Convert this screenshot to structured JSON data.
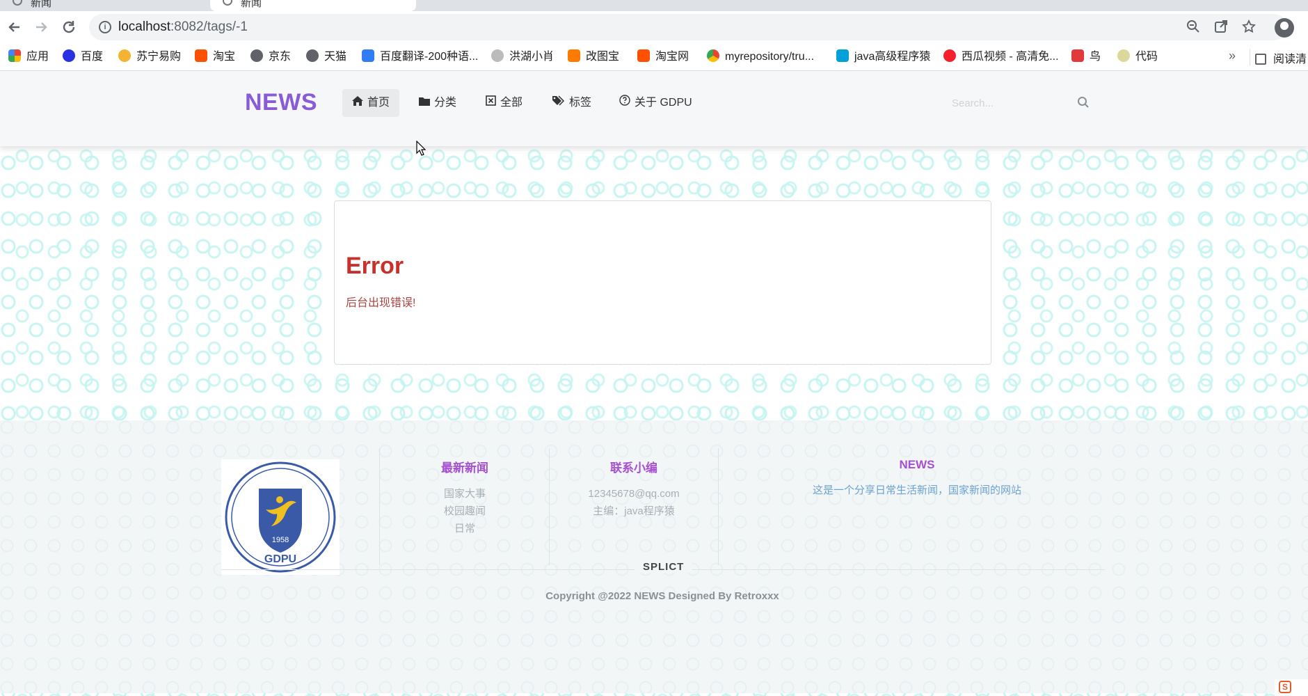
{
  "browser": {
    "tabs": [
      {
        "title": "新闻"
      },
      {
        "title": "新闻"
      }
    ],
    "url": "localhost:8082/tags/-1",
    "url_host": "localhost",
    "url_path": ":8082/tags/-1",
    "bookmarks": [
      {
        "label": "应用",
        "icon": "apps-grid-icon",
        "color": "#4285f4"
      },
      {
        "label": "百度",
        "icon": "baidu-paw-icon",
        "color": "#2932e1"
      },
      {
        "label": "苏宁易购",
        "icon": "suning-icon",
        "color": "#f5b335"
      },
      {
        "label": "淘宝",
        "icon": "taobao-icon",
        "color": "#ff5000"
      },
      {
        "label": "京东",
        "icon": "globe-icon",
        "color": "#5f6368"
      },
      {
        "label": "天猫",
        "icon": "globe-icon",
        "color": "#5f6368"
      },
      {
        "label": "百度翻译-200种语...",
        "icon": "translate-icon",
        "color": "#2f7cf6"
      },
      {
        "label": "洪湖小肖",
        "icon": "bird-icon",
        "color": "#777777"
      },
      {
        "label": "改图宝",
        "icon": "gaitubao-icon",
        "color": "#ff7a00"
      },
      {
        "label": "淘宝网",
        "icon": "taobao-icon",
        "color": "#ff5000"
      },
      {
        "label": "myrepository/tru...",
        "icon": "chrome-icon",
        "color": "#34a853"
      },
      {
        "label": "java高级程序猿",
        "icon": "bilibili-icon",
        "color": "#00a1d6"
      },
      {
        "label": "西瓜视频 - 高清免...",
        "icon": "xigua-icon",
        "color": "#f5222d"
      },
      {
        "label": "鸟",
        "icon": "bird-red-icon",
        "color": "#e03a3a"
      },
      {
        "label": "代码",
        "icon": "leaf-icon",
        "color": "#c9c27a"
      }
    ],
    "more": "»",
    "reader_mode": "阅读清"
  },
  "nav": {
    "brand": "NEWS",
    "items": [
      {
        "label": "首页",
        "icon": "home-icon",
        "active": true
      },
      {
        "label": "分类",
        "icon": "folder-icon",
        "active": false
      },
      {
        "label": "全部",
        "icon": "square-x-icon",
        "active": false
      },
      {
        "label": "标签",
        "icon": "tags-icon",
        "active": false
      },
      {
        "label": "关于 GDPU",
        "icon": "question-circle-icon",
        "active": false
      }
    ],
    "search": {
      "placeholder": "Search...",
      "value": ""
    }
  },
  "error": {
    "title": "Error",
    "message": "后台出现错误!"
  },
  "footer": {
    "logo_alt": "GDPU",
    "logo_year": "1958",
    "logo_text": "GDPU",
    "latest_news": {
      "heading": "最新新闻",
      "items": [
        "国家大事",
        "校园趣闻",
        "日常"
      ]
    },
    "contact": {
      "heading": "联系小编",
      "items": [
        "12345678@qq.com",
        "主编：java程序猿"
      ]
    },
    "about": {
      "heading": "NEWS",
      "description": "这是一个分享日常生活新闻，国家新闻的网站"
    },
    "divider_label": "SPLICT",
    "copyright": "Copyright @2022 NEWS Designed By Retroxxx"
  },
  "colors": {
    "brand": "#8a5bd6",
    "error": "#c9302c",
    "footer_heading": "#a64fd1",
    "footer_link": "#6aa2d4",
    "pattern": "#c6f4f1"
  }
}
